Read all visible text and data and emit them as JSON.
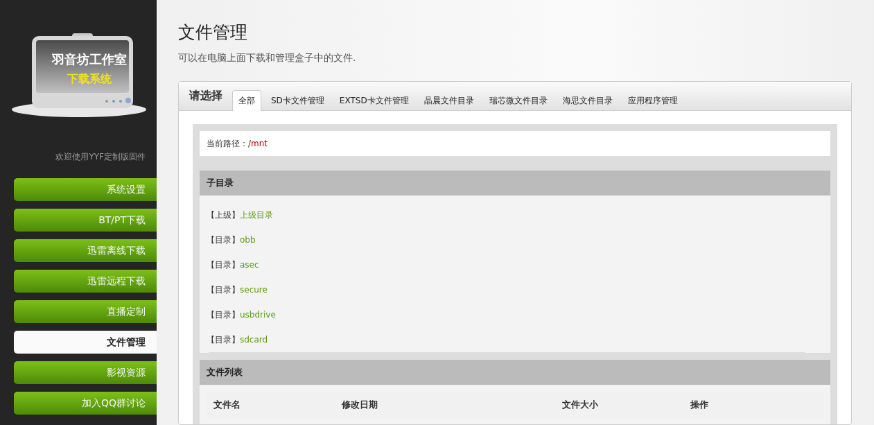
{
  "logo": {
    "title": "羽音坊工作室",
    "subtitle": "下载系统"
  },
  "welcome": "欢迎使用YYF定制版固件",
  "nav": [
    {
      "label": "系统设置",
      "selected": false
    },
    {
      "label": "BT/PT下载",
      "selected": false
    },
    {
      "label": "迅雷离线下载",
      "selected": false
    },
    {
      "label": "迅雷远程下载",
      "selected": false
    },
    {
      "label": "直播定制",
      "selected": false
    },
    {
      "label": "文件管理",
      "selected": true
    },
    {
      "label": "影视资源",
      "selected": false
    },
    {
      "label": "加入QQ群讨论",
      "selected": false
    }
  ],
  "page": {
    "title": "文件管理",
    "subtitle": "可以在电脑上面下载和管理盒子中的文件."
  },
  "panel": {
    "heading": "请选择",
    "tabs": [
      {
        "label": "全部",
        "selected": true
      },
      {
        "label": "SD卡文件管理",
        "selected": false
      },
      {
        "label": "EXTSD卡文件管理",
        "selected": false
      },
      {
        "label": "晶晨文件目录",
        "selected": false
      },
      {
        "label": "瑞芯微文件目录",
        "selected": false
      },
      {
        "label": "海思文件目录",
        "selected": false
      },
      {
        "label": "应用程序管理",
        "selected": false
      }
    ]
  },
  "path": {
    "label": "当前路径：",
    "value": "/mnt"
  },
  "subdirs": {
    "heading": "子目录",
    "items": [
      {
        "tag": "【上级】",
        "name": "上级目录"
      },
      {
        "tag": "【目录】",
        "name": "obb"
      },
      {
        "tag": "【目录】",
        "name": "asec"
      },
      {
        "tag": "【目录】",
        "name": "secure"
      },
      {
        "tag": "【目录】",
        "name": "usbdrive"
      },
      {
        "tag": "【目录】",
        "name": "sdcard"
      }
    ]
  },
  "files": {
    "heading": "文件列表",
    "columns": [
      "文件名",
      "修改日期",
      "文件大小",
      "操作"
    ]
  }
}
